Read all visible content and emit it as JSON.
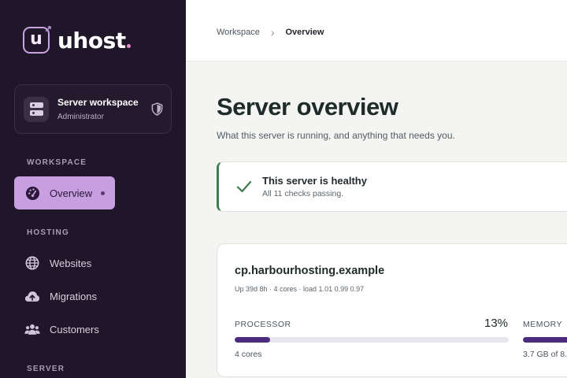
{
  "brand": {
    "name": "uhost"
  },
  "workspace_card": {
    "title": "Server workspace",
    "role": "Administrator"
  },
  "sidebar": {
    "sections": [
      {
        "label": "WORKSPACE"
      },
      {
        "label": "HOSTING"
      },
      {
        "label": "SERVER"
      }
    ],
    "items": [
      {
        "label": "Overview",
        "icon": "dashboard-gauge-icon",
        "active": true
      },
      {
        "label": "Websites",
        "icon": "globe-icon"
      },
      {
        "label": "Migrations",
        "icon": "cloud-upload-icon"
      },
      {
        "label": "Customers",
        "icon": "users-icon"
      }
    ]
  },
  "breadcrumb": {
    "root": "Workspace",
    "current": "Overview"
  },
  "page": {
    "title": "Server overview",
    "subtitle": "What this server is running, and anything that needs you."
  },
  "health": {
    "title": "This server is healthy",
    "detail": "All 11 checks passing.",
    "status_color": "#3e7d4f"
  },
  "server": {
    "hostname": "cp.harbourhosting.example",
    "meta": "Up 39d 8h · 4 cores · load 1.01 0.99 0.97",
    "processor": {
      "label": "PROCESSOR",
      "value": "13%",
      "percent": 13,
      "sub": "4 cores"
    },
    "memory": {
      "label": "MEMORY",
      "sub": "3.7 GB of 8."
    }
  },
  "colors": {
    "sidebar_bg": "#1f1629",
    "accent": "#c79ee0",
    "bar_fill": "#4a2b7d"
  }
}
